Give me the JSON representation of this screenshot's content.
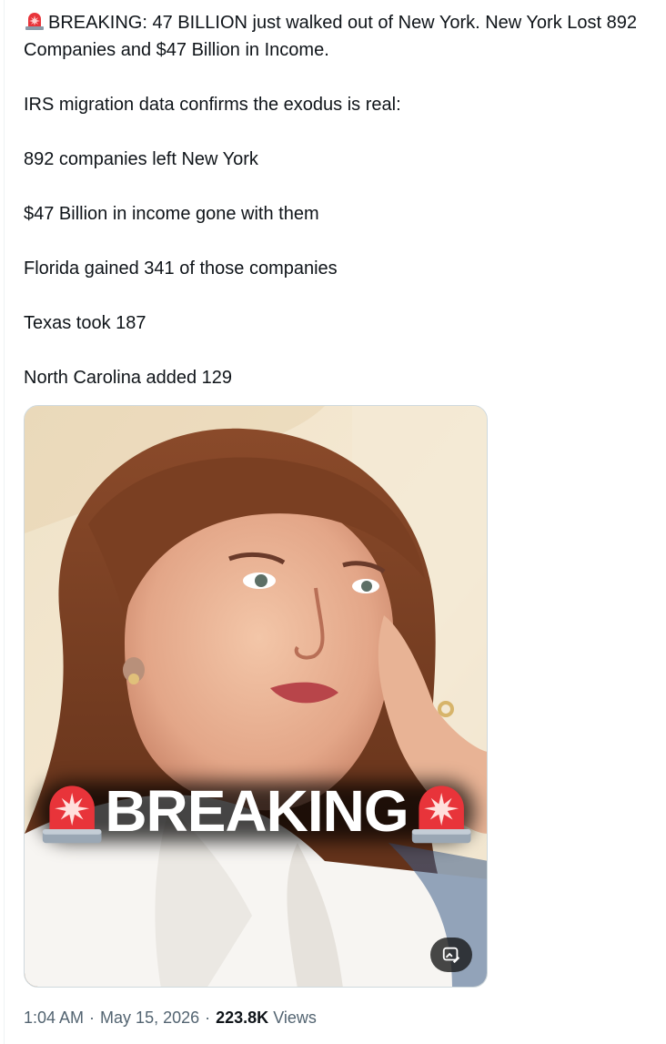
{
  "tweet": {
    "headline": "BREAKING: 47 BILLION just walked out of New York. New York Lost 892 Companies and $47 Billion in Income.",
    "line_1": "IRS migration data confirms the exodus is real:",
    "line_2": "892 companies left New York",
    "line_3": "$47 Billion in income gone with them",
    "line_4": "Florida gained 341 of those companies",
    "line_5": "Texas took 187",
    "line_6": "North Carolina added 129"
  },
  "media": {
    "overlay_text": "BREAKING",
    "alt_icon": "edit-image-icon"
  },
  "meta": {
    "time": "1:04 AM",
    "date": "May 15, 2026",
    "separator": "·",
    "views_count": "223.8K",
    "views_label": "Views"
  },
  "icons": {
    "siren": "siren-icon"
  },
  "colors": {
    "text": "#0f1419",
    "secondary": "#536471",
    "border": "#cfd9de",
    "siren_red": "#e8343a"
  }
}
